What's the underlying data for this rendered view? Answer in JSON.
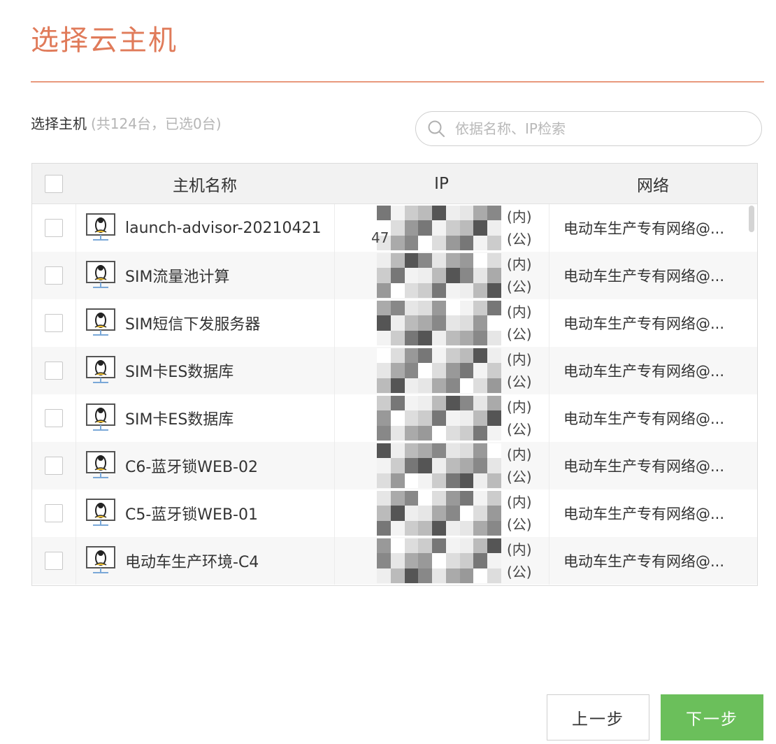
{
  "dialog": {
    "title": "选择云主机"
  },
  "selection": {
    "label": "选择主机",
    "count_text": "(共124台，已选0台)"
  },
  "search": {
    "placeholder": "依据名称、IP检索",
    "value": ""
  },
  "table": {
    "headers": {
      "name": "主机名称",
      "ip": "IP",
      "network": "网络"
    },
    "ip_tag_private": "(内)",
    "ip_tag_public": "(公)",
    "rows": [
      {
        "name": "launch-advisor-20210421",
        "network": "电动车生产专有网络@...",
        "ip_fragment": "47",
        "checked": false
      },
      {
        "name": "SIM流量池计算",
        "network": "电动车生产专有网络@...",
        "ip_fragment": "",
        "checked": false
      },
      {
        "name": "SIM短信下发服务器",
        "network": "电动车生产专有网络@...",
        "ip_fragment": "",
        "checked": false
      },
      {
        "name": "SIM卡ES数据库",
        "network": "电动车生产专有网络@...",
        "ip_fragment": "",
        "checked": false
      },
      {
        "name": "SIM卡ES数据库",
        "network": "电动车生产专有网络@...",
        "ip_fragment": "",
        "checked": false
      },
      {
        "name": "C6-蓝牙锁WEB-02",
        "network": "电动车生产专有网络@...",
        "ip_fragment": "",
        "checked": false
      },
      {
        "name": "C5-蓝牙锁WEB-01",
        "network": "电动车生产专有网络@...",
        "ip_fragment": "",
        "checked": false
      },
      {
        "name": "电动车生产环境-C4",
        "network": "电动车生产专有网络@...",
        "ip_fragment": "",
        "checked": false
      }
    ]
  },
  "icons": {
    "search": "search-icon",
    "host": "linux-host-icon"
  },
  "colors": {
    "title": "#e07b5a",
    "divider": "#e8997d",
    "primary_button": "#6bbf5b"
  },
  "footer": {
    "prev_label": "上一步",
    "next_label": "下一步"
  }
}
